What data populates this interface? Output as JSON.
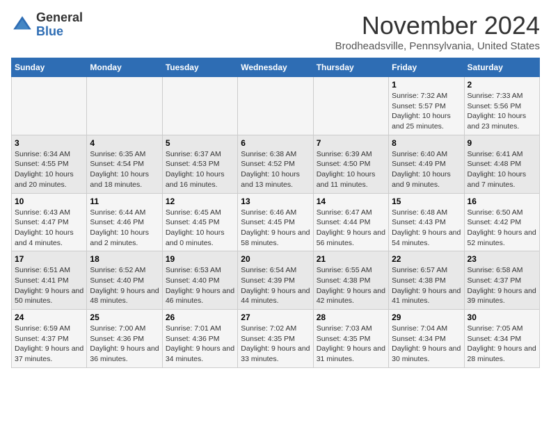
{
  "header": {
    "logo_general": "General",
    "logo_blue": "Blue",
    "month_title": "November 2024",
    "location": "Brodheadsville, Pennsylvania, United States"
  },
  "days_of_week": [
    "Sunday",
    "Monday",
    "Tuesday",
    "Wednesday",
    "Thursday",
    "Friday",
    "Saturday"
  ],
  "weeks": [
    [
      {
        "day": "",
        "info": ""
      },
      {
        "day": "",
        "info": ""
      },
      {
        "day": "",
        "info": ""
      },
      {
        "day": "",
        "info": ""
      },
      {
        "day": "",
        "info": ""
      },
      {
        "day": "1",
        "info": "Sunrise: 7:32 AM\nSunset: 5:57 PM\nDaylight: 10 hours and 25 minutes."
      },
      {
        "day": "2",
        "info": "Sunrise: 7:33 AM\nSunset: 5:56 PM\nDaylight: 10 hours and 23 minutes."
      }
    ],
    [
      {
        "day": "3",
        "info": "Sunrise: 6:34 AM\nSunset: 4:55 PM\nDaylight: 10 hours and 20 minutes."
      },
      {
        "day": "4",
        "info": "Sunrise: 6:35 AM\nSunset: 4:54 PM\nDaylight: 10 hours and 18 minutes."
      },
      {
        "day": "5",
        "info": "Sunrise: 6:37 AM\nSunset: 4:53 PM\nDaylight: 10 hours and 16 minutes."
      },
      {
        "day": "6",
        "info": "Sunrise: 6:38 AM\nSunset: 4:52 PM\nDaylight: 10 hours and 13 minutes."
      },
      {
        "day": "7",
        "info": "Sunrise: 6:39 AM\nSunset: 4:50 PM\nDaylight: 10 hours and 11 minutes."
      },
      {
        "day": "8",
        "info": "Sunrise: 6:40 AM\nSunset: 4:49 PM\nDaylight: 10 hours and 9 minutes."
      },
      {
        "day": "9",
        "info": "Sunrise: 6:41 AM\nSunset: 4:48 PM\nDaylight: 10 hours and 7 minutes."
      }
    ],
    [
      {
        "day": "10",
        "info": "Sunrise: 6:43 AM\nSunset: 4:47 PM\nDaylight: 10 hours and 4 minutes."
      },
      {
        "day": "11",
        "info": "Sunrise: 6:44 AM\nSunset: 4:46 PM\nDaylight: 10 hours and 2 minutes."
      },
      {
        "day": "12",
        "info": "Sunrise: 6:45 AM\nSunset: 4:45 PM\nDaylight: 10 hours and 0 minutes."
      },
      {
        "day": "13",
        "info": "Sunrise: 6:46 AM\nSunset: 4:45 PM\nDaylight: 9 hours and 58 minutes."
      },
      {
        "day": "14",
        "info": "Sunrise: 6:47 AM\nSunset: 4:44 PM\nDaylight: 9 hours and 56 minutes."
      },
      {
        "day": "15",
        "info": "Sunrise: 6:48 AM\nSunset: 4:43 PM\nDaylight: 9 hours and 54 minutes."
      },
      {
        "day": "16",
        "info": "Sunrise: 6:50 AM\nSunset: 4:42 PM\nDaylight: 9 hours and 52 minutes."
      }
    ],
    [
      {
        "day": "17",
        "info": "Sunrise: 6:51 AM\nSunset: 4:41 PM\nDaylight: 9 hours and 50 minutes."
      },
      {
        "day": "18",
        "info": "Sunrise: 6:52 AM\nSunset: 4:40 PM\nDaylight: 9 hours and 48 minutes."
      },
      {
        "day": "19",
        "info": "Sunrise: 6:53 AM\nSunset: 4:40 PM\nDaylight: 9 hours and 46 minutes."
      },
      {
        "day": "20",
        "info": "Sunrise: 6:54 AM\nSunset: 4:39 PM\nDaylight: 9 hours and 44 minutes."
      },
      {
        "day": "21",
        "info": "Sunrise: 6:55 AM\nSunset: 4:38 PM\nDaylight: 9 hours and 42 minutes."
      },
      {
        "day": "22",
        "info": "Sunrise: 6:57 AM\nSunset: 4:38 PM\nDaylight: 9 hours and 41 minutes."
      },
      {
        "day": "23",
        "info": "Sunrise: 6:58 AM\nSunset: 4:37 PM\nDaylight: 9 hours and 39 minutes."
      }
    ],
    [
      {
        "day": "24",
        "info": "Sunrise: 6:59 AM\nSunset: 4:37 PM\nDaylight: 9 hours and 37 minutes."
      },
      {
        "day": "25",
        "info": "Sunrise: 7:00 AM\nSunset: 4:36 PM\nDaylight: 9 hours and 36 minutes."
      },
      {
        "day": "26",
        "info": "Sunrise: 7:01 AM\nSunset: 4:36 PM\nDaylight: 9 hours and 34 minutes."
      },
      {
        "day": "27",
        "info": "Sunrise: 7:02 AM\nSunset: 4:35 PM\nDaylight: 9 hours and 33 minutes."
      },
      {
        "day": "28",
        "info": "Sunrise: 7:03 AM\nSunset: 4:35 PM\nDaylight: 9 hours and 31 minutes."
      },
      {
        "day": "29",
        "info": "Sunrise: 7:04 AM\nSunset: 4:34 PM\nDaylight: 9 hours and 30 minutes."
      },
      {
        "day": "30",
        "info": "Sunrise: 7:05 AM\nSunset: 4:34 PM\nDaylight: 9 hours and 28 minutes."
      }
    ]
  ]
}
